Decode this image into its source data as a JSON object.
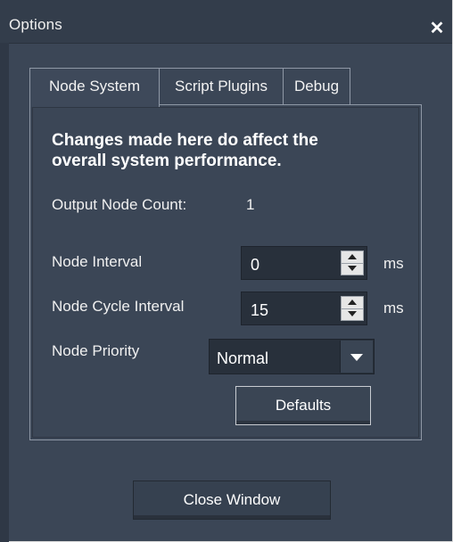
{
  "window": {
    "title": "Options",
    "close_symbol": "✕"
  },
  "tabs": [
    {
      "label": "Node System",
      "active": true
    },
    {
      "label": "Script Plugins",
      "active": false
    },
    {
      "label": "Debug",
      "active": false
    }
  ],
  "panel": {
    "warning_line1": "Changes made here do affect the",
    "warning_line2": "overall system performance.",
    "output_node_count_label": "Output Node Count:",
    "output_node_count_value": "1",
    "node_interval": {
      "label": "Node Interval",
      "value": "0",
      "unit": "ms"
    },
    "node_cycle_interval": {
      "label": "Node Cycle Interval",
      "value": "15",
      "unit": "ms"
    },
    "node_priority": {
      "label": "Node Priority",
      "selected": "Normal"
    },
    "defaults_label": "Defaults"
  },
  "footer": {
    "close_label": "Close Window"
  },
  "colors": {
    "background": "#3b4656",
    "titlebar": "#333d4b",
    "field": "#28303b"
  }
}
